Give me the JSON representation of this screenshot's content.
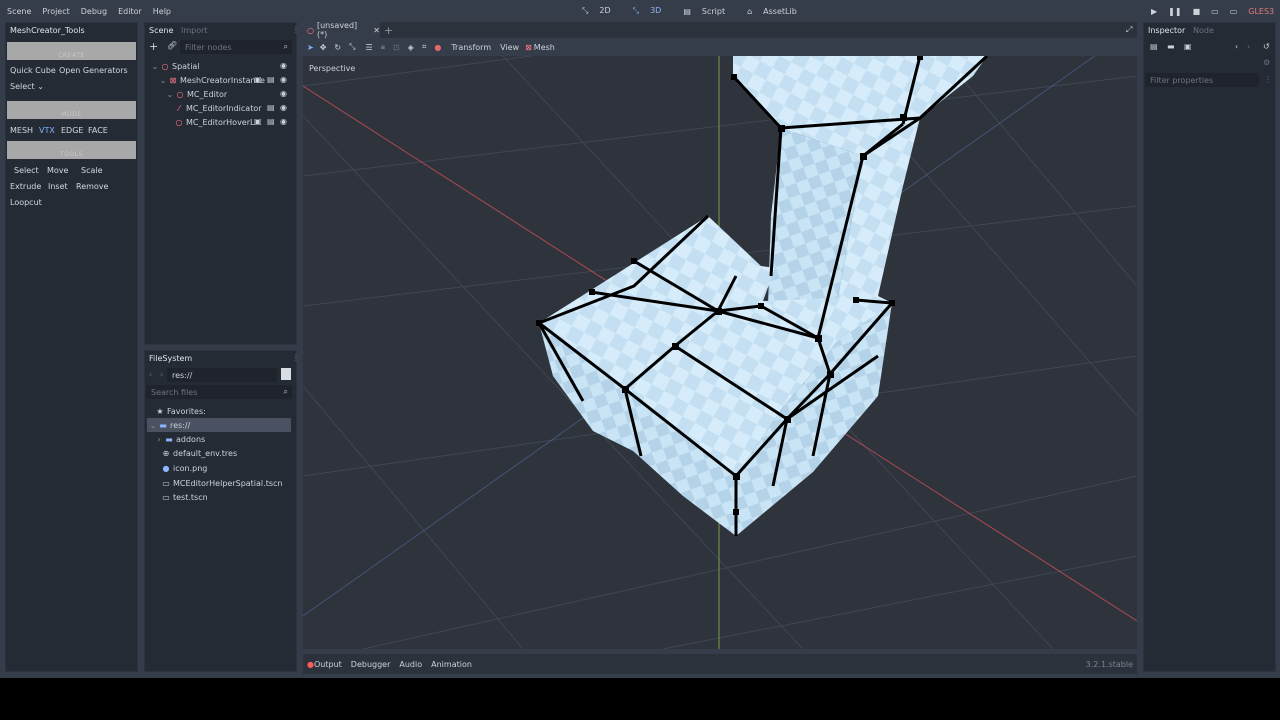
{
  "menu": [
    "Scene",
    "Project",
    "Debug",
    "Editor",
    "Help"
  ],
  "workspaces": [
    "2D",
    "3D",
    "Script",
    "AssetLib"
  ],
  "renderer": "GLES3",
  "left_dock": {
    "tab": "MeshCreator_Tools",
    "create_label": "CREATE",
    "quick_cube": "Quick Cube",
    "open_generators": "Open Generators",
    "select_dropdown": "Select",
    "mode_label": "MODE",
    "modes": [
      "MESH",
      "VTX",
      "EDGE",
      "FACE"
    ],
    "tools_label": "TOOLS",
    "tools": [
      "Select",
      "Move",
      "Scale",
      "Extrude",
      "Inset",
      "Remove",
      "Loopcut"
    ]
  },
  "scene_dock": {
    "tabs": [
      "Scene",
      "Import"
    ],
    "filter_placeholder": "Filter nodes",
    "nodes": [
      "Spatial",
      "MeshCreatorInstance",
      "MC_Editor",
      "MC_EditorIndicator",
      "MC_EditorHoverL"
    ]
  },
  "filesystem": {
    "tab": "FileSystem",
    "path": "res://",
    "search_placeholder": "Search files",
    "favorites": "Favorites:",
    "root": "res://",
    "items": [
      "addons",
      "default_env.tres",
      "icon.png",
      "MCEditorHelperSpatial.tscn",
      "test.tscn"
    ]
  },
  "editor": {
    "scene_tab": "[unsaved](*)",
    "menus": [
      "Transform",
      "View",
      "Mesh"
    ],
    "perspective": "Perspective"
  },
  "inspector": {
    "tabs": [
      "Inspector",
      "Node"
    ],
    "filter_placeholder": "Filter properties"
  },
  "bottom": {
    "tabs": [
      "Output",
      "Debugger",
      "Audio",
      "Animation"
    ],
    "version": "3.2.1.stable"
  },
  "colors": {
    "background": "#363d4a",
    "panel": "#252b35",
    "accent": "#699ce8",
    "mesh": "#d4ecfb",
    "x_axis": "#c8505a",
    "y_axis": "#8fba4a"
  }
}
